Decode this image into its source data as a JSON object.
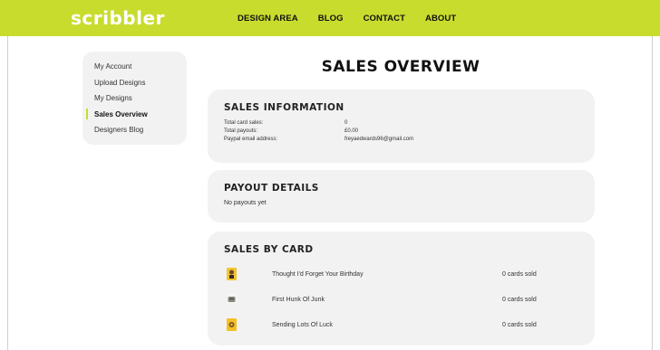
{
  "header": {
    "logo": "scribbler",
    "nav": [
      "DESIGN AREA",
      "BLOG",
      "CONTACT",
      "ABOUT"
    ]
  },
  "sidebar": {
    "items": [
      {
        "label": "My Account",
        "active": false
      },
      {
        "label": "Upload Designs",
        "active": false
      },
      {
        "label": "My Designs",
        "active": false
      },
      {
        "label": "Sales Overview",
        "active": true
      },
      {
        "label": "Designers Blog",
        "active": false
      }
    ]
  },
  "page_title": "SALES OVERVIEW",
  "sales_info": {
    "title": "SALES INFORMATION",
    "rows": [
      {
        "label": "Total card sales:",
        "value": "0"
      },
      {
        "label": "Total payouts:",
        "value": "£0.00"
      },
      {
        "label": "Paypal email address:",
        "value": "freyaedwards96@gmail.com"
      }
    ]
  },
  "payout": {
    "title": "PAYOUT DETAILS",
    "message": "No payouts yet"
  },
  "sales_by_card": {
    "title": "SALES BY CARD",
    "cards": [
      {
        "name": "Thought I'd Forget Your Birthday",
        "count": "0 cards sold",
        "thumb_color": "#f2c531"
      },
      {
        "name": "First Hunk Of Junk",
        "count": "0 cards sold",
        "thumb_color": "#9b9b93"
      },
      {
        "name": "Sending Lots Of Luck",
        "count": "0 cards sold",
        "thumb_color": "#f5c024"
      }
    ]
  },
  "colors": {
    "accent": "#c8dc2e",
    "panel": "#f2f2f2"
  }
}
